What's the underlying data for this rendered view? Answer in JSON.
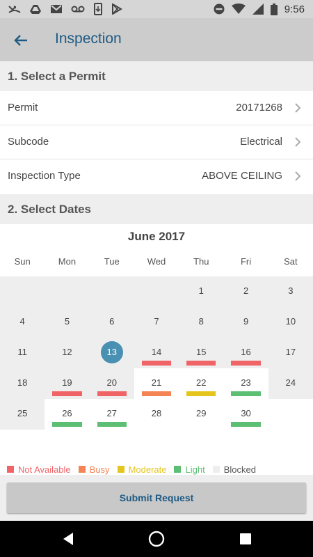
{
  "status_bar": {
    "time": "9:56"
  },
  "app_bar": {
    "title": "Inspection"
  },
  "section_permit": {
    "header": "1. Select a Permit"
  },
  "permit_rows": [
    {
      "label": "Permit",
      "value": "20171268"
    },
    {
      "label": "Subcode",
      "value": "Electrical"
    },
    {
      "label": "Inspection Type",
      "value": "ABOVE CEILING"
    }
  ],
  "section_dates": {
    "header": "2. Select Dates"
  },
  "calendar": {
    "month_label": "June 2017",
    "weekdays": [
      "Sun",
      "Mon",
      "Tue",
      "Wed",
      "Thu",
      "Fri",
      "Sat"
    ],
    "selected_day": "13",
    "weeks": [
      [
        {
          "day": "",
          "bg": "gray"
        },
        {
          "day": "",
          "bg": "gray"
        },
        {
          "day": "",
          "bg": "gray"
        },
        {
          "day": "",
          "bg": "gray"
        },
        {
          "day": "1",
          "bg": "gray"
        },
        {
          "day": "2",
          "bg": "gray"
        },
        {
          "day": "3",
          "bg": "gray"
        }
      ],
      [
        {
          "day": "4",
          "bg": "gray"
        },
        {
          "day": "5",
          "bg": "gray"
        },
        {
          "day": "6",
          "bg": "gray"
        },
        {
          "day": "7",
          "bg": "gray"
        },
        {
          "day": "8",
          "bg": "gray"
        },
        {
          "day": "9",
          "bg": "gray"
        },
        {
          "day": "10",
          "bg": "gray"
        }
      ],
      [
        {
          "day": "11",
          "bg": "gray"
        },
        {
          "day": "12",
          "bg": "gray"
        },
        {
          "day": "13",
          "bg": "gray",
          "selected": true
        },
        {
          "day": "14",
          "bg": "gray",
          "status": "not_available"
        },
        {
          "day": "15",
          "bg": "gray",
          "status": "not_available"
        },
        {
          "day": "16",
          "bg": "gray",
          "status": "not_available"
        },
        {
          "day": "17",
          "bg": "gray"
        }
      ],
      [
        {
          "day": "18",
          "bg": "gray"
        },
        {
          "day": "19",
          "bg": "gray",
          "status": "not_available"
        },
        {
          "day": "20",
          "bg": "gray",
          "status": "not_available"
        },
        {
          "day": "21",
          "bg": "white",
          "status": "busy"
        },
        {
          "day": "22",
          "bg": "white",
          "status": "moderate"
        },
        {
          "day": "23",
          "bg": "white",
          "status": "light"
        },
        {
          "day": "24",
          "bg": "gray"
        }
      ],
      [
        {
          "day": "25",
          "bg": "gray"
        },
        {
          "day": "26",
          "bg": "white",
          "status": "light"
        },
        {
          "day": "27",
          "bg": "white",
          "status": "light"
        },
        {
          "day": "28",
          "bg": "white"
        },
        {
          "day": "29",
          "bg": "white"
        },
        {
          "day": "30",
          "bg": "white",
          "status": "light"
        },
        {
          "day": "",
          "bg": "white"
        }
      ]
    ]
  },
  "legend": [
    {
      "key": "not_available",
      "label": "Not Available",
      "color": "#f06467"
    },
    {
      "key": "busy",
      "label": "Busy",
      "color": "#f48453"
    },
    {
      "key": "moderate",
      "label": "Moderate",
      "color": "#e3c51e"
    },
    {
      "key": "light",
      "label": "Light",
      "color": "#5dbf74"
    },
    {
      "key": "blocked",
      "label": "Blocked",
      "color": "#eeeeee",
      "text_color": "#555555"
    }
  ],
  "colors": {
    "accent": "#1d5a84",
    "selected_day": "#4a90b2",
    "gray_cell": "#eeeeee"
  },
  "submit": {
    "label": "Submit Request"
  }
}
